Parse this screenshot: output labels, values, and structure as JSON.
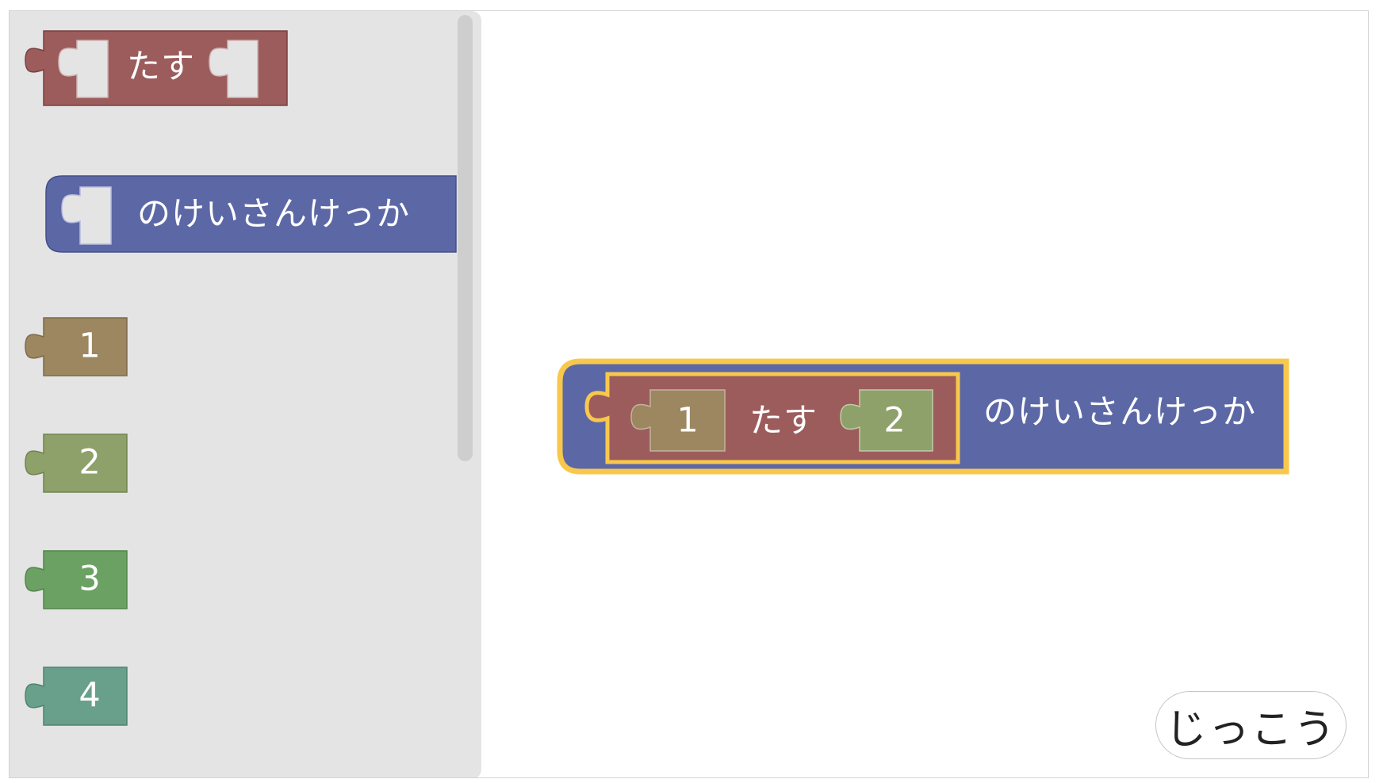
{
  "toolbox": {
    "add_block": {
      "label": "たす"
    },
    "result_block": {
      "label": "のけいさんけっか"
    },
    "numbers": [
      {
        "label": "1",
        "color": "#9c8760"
      },
      {
        "label": "2",
        "color": "#8fa16a"
      },
      {
        "label": "3",
        "color": "#6ba263"
      },
      {
        "label": "4",
        "color": "#69a08b"
      }
    ]
  },
  "workspace": {
    "result_label": "のけいさんけっか",
    "add_label": "たす",
    "left_operand": "1",
    "right_operand": "2"
  },
  "run_button": {
    "label": "じっこう"
  },
  "colors": {
    "add_block": "#9c5c5c",
    "result_block": "#5c68a6",
    "selection_highlight": "#f8c84c",
    "toolbox_bg": "#e4e4e4"
  }
}
